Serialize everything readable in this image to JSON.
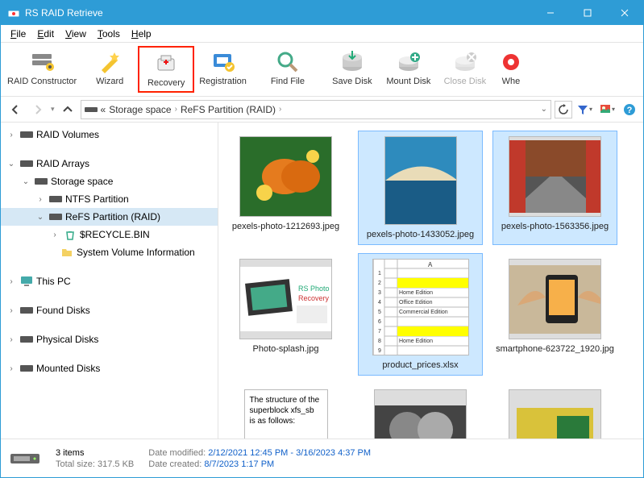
{
  "app": {
    "title": "RS RAID Retrieve"
  },
  "menu": {
    "file": "File",
    "edit": "Edit",
    "view": "View",
    "tools": "Tools",
    "help": "Help"
  },
  "toolbar": {
    "raid_constructor": "RAID Constructor",
    "wizard": "Wizard",
    "recovery": "Recovery",
    "registration": "Registration",
    "find_file": "Find File",
    "save_disk": "Save Disk",
    "mount_disk": "Mount Disk",
    "close_disk": "Close Disk",
    "wheel": "Whe"
  },
  "breadcrumb": {
    "prefix": "«",
    "seg1": "Storage space",
    "seg2": "ReFS Partition (RAID)"
  },
  "tree": {
    "raid_volumes": "RAID Volumes",
    "raid_arrays": "RAID Arrays",
    "storage_space": "Storage space",
    "ntfs": "NTFS Partition",
    "refs": "ReFS Partition (RAID)",
    "recycle": "$RECYCLE.BIN",
    "sysvol": "System Volume Information",
    "this_pc": "This PC",
    "found_disks": "Found Disks",
    "physical_disks": "Physical Disks",
    "mounted_disks": "Mounted Disks"
  },
  "files": [
    {
      "name": "pexels-photo-1212693.jpeg",
      "selected": false,
      "kind": "butterfly"
    },
    {
      "name": "pexels-photo-1433052.jpeg",
      "selected": true,
      "kind": "beach"
    },
    {
      "name": "pexels-photo-1563356.jpeg",
      "selected": true,
      "kind": "road"
    },
    {
      "name": "Photo-splash.jpg",
      "selected": false,
      "kind": "splash"
    },
    {
      "name": "product_prices.xlsx",
      "selected": true,
      "kind": "sheet"
    },
    {
      "name": "smartphone-623722_1920.jpg",
      "selected": false,
      "kind": "phone"
    },
    {
      "name": "",
      "selected": false,
      "kind": "text"
    },
    {
      "name": "",
      "selected": false,
      "kind": "abstract"
    },
    {
      "name": "",
      "selected": false,
      "kind": "yellow"
    }
  ],
  "textdoc": "The structure of the superblock xfs_sb is as follows:",
  "sheet": {
    "r3": "Home Edition",
    "r4": "Office Edition",
    "r5": "Commercial Edition",
    "r8": "Home Edition"
  },
  "status": {
    "items_label": "3 items",
    "total_label": "Total size:",
    "total_val": "317.5 KB",
    "mod_label": "Date modified:",
    "mod_val": "2/12/2021 12:45 PM - 3/16/2023 4:37 PM",
    "created_label": "Date created:",
    "created_val": "8/7/2023 1:17 PM"
  }
}
